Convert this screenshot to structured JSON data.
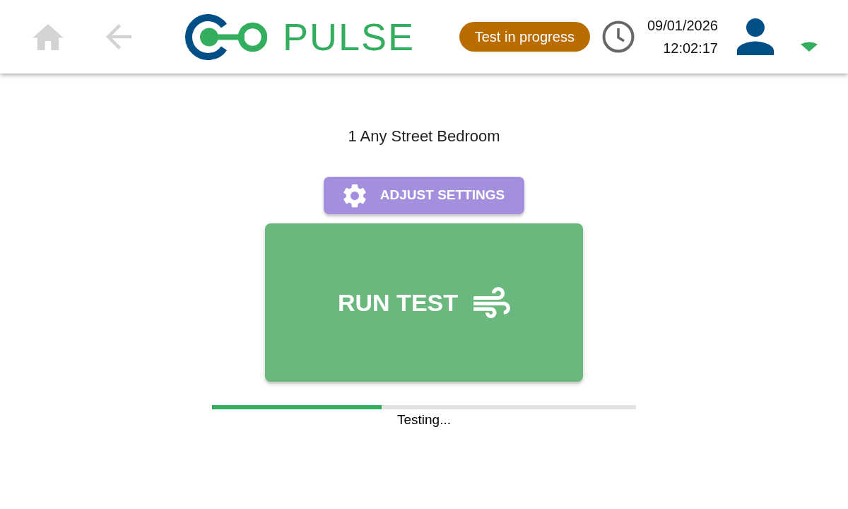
{
  "header": {
    "nav_buttons": [
      {
        "kind": "home",
        "disabled": true
      },
      {
        "kind": "back",
        "disabled": true
      }
    ],
    "logo": {
      "text": "PULSE"
    },
    "status_badge": {
      "label": "Test in progress"
    },
    "clock": {
      "date": "09/01/2026",
      "time": "12:02:17"
    }
  },
  "main": {
    "location": "1 Any Street Bedroom",
    "settings_button": {
      "label": "ADJUST SETTINGS",
      "disabled": true
    },
    "run_button": {
      "label": "RUN TEST",
      "disabled": true
    },
    "progress": {
      "level": 0.4,
      "label": "Testing..."
    }
  }
}
